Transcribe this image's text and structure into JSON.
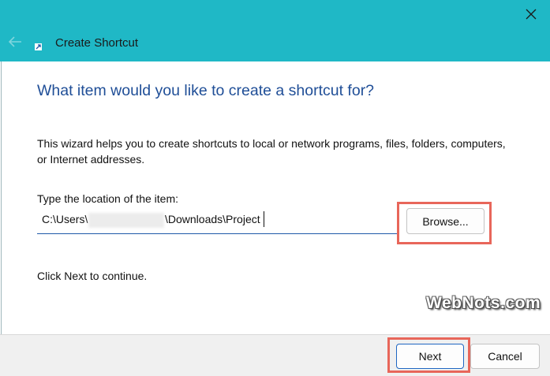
{
  "window": {
    "title": "Create Shortcut",
    "titlebar_color": "#1fb8c6",
    "back_icon": "back-arrow-icon",
    "close_icon": "close-icon",
    "shortcut_icon": "shortcut-arrow-icon"
  },
  "main": {
    "heading": "What item would you like to create a shortcut for?",
    "description": "This wizard helps you to create shortcuts to local or network programs, files, folders, computers, or Internet addresses.",
    "location_label": "Type the location of the item:",
    "location_prefix": "C:\\Users\\",
    "location_suffix": "\\Downloads\\Project",
    "browse_label": "Browse...",
    "continue_text": "Click Next to continue."
  },
  "watermark": "WebNots.com",
  "footer": {
    "next_label": "Next",
    "cancel_label": "Cancel"
  },
  "highlight_color": "#e8665a"
}
